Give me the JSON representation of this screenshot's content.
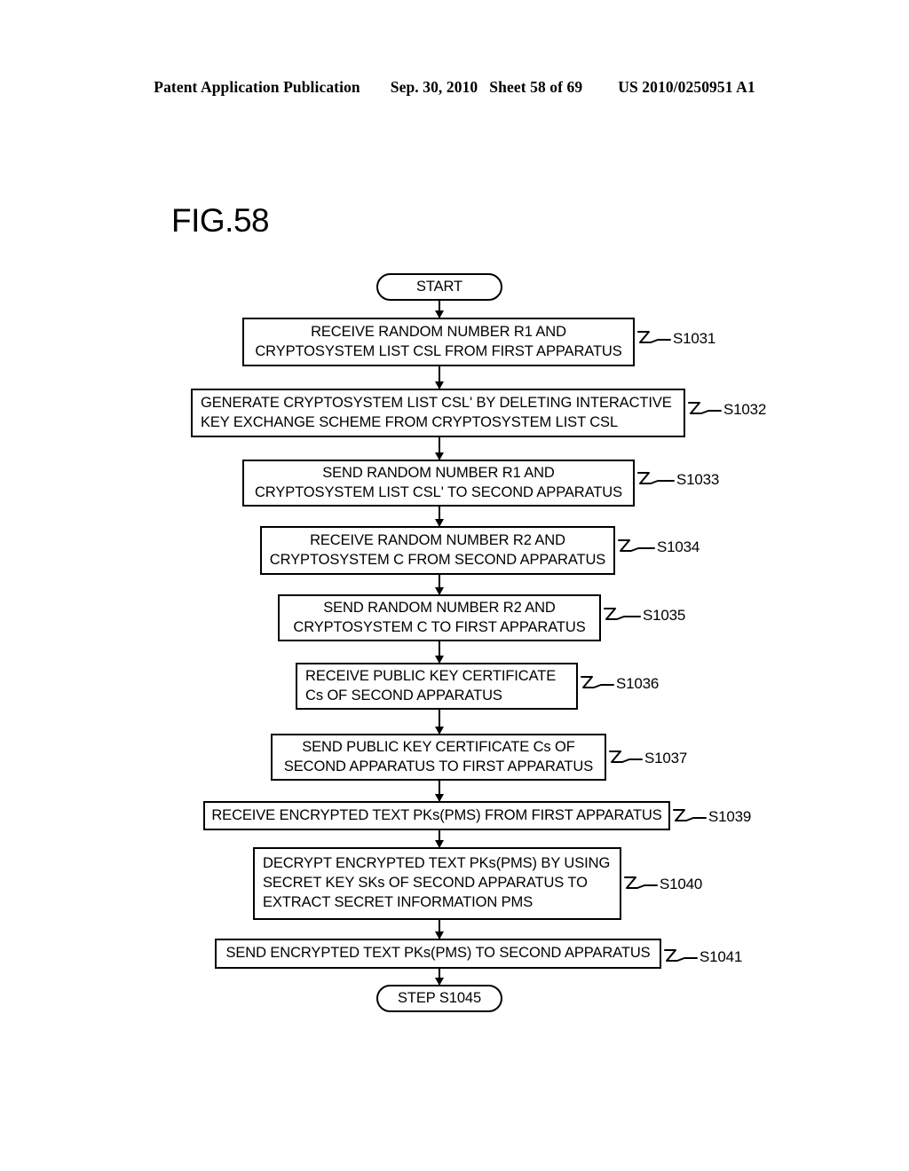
{
  "header": {
    "publication": "Patent Application Publication",
    "date": "Sep. 30, 2010",
    "sheet": "Sheet 58 of 69",
    "patent_number": "US 2010/0250951 A1"
  },
  "figure": {
    "label": "FIG.58"
  },
  "flowchart": {
    "start_label": "START",
    "end_label": "STEP S1045",
    "steps": [
      {
        "ref": "S1031",
        "lines": [
          "RECEIVE RANDOM NUMBER R1 AND",
          "CRYPTOSYSTEM LIST CSL FROM FIRST APPARATUS"
        ]
      },
      {
        "ref": "S1032",
        "lines": [
          "GENERATE CRYPTOSYSTEM LIST CSL' BY DELETING INTERACTIVE",
          "KEY EXCHANGE SCHEME FROM CRYPTOSYSTEM LIST CSL"
        ]
      },
      {
        "ref": "S1033",
        "lines": [
          "SEND RANDOM NUMBER R1 AND",
          "CRYPTOSYSTEM LIST CSL' TO SECOND APPARATUS"
        ]
      },
      {
        "ref": "S1034",
        "lines": [
          "RECEIVE RANDOM NUMBER R2 AND",
          "CRYPTOSYSTEM C FROM SECOND APPARATUS"
        ]
      },
      {
        "ref": "S1035",
        "lines": [
          "SEND RANDOM NUMBER R2 AND",
          "CRYPTOSYSTEM C TO FIRST APPARATUS"
        ]
      },
      {
        "ref": "S1036",
        "lines": [
          "RECEIVE PUBLIC KEY CERTIFICATE",
          "Cs OF SECOND APPARATUS"
        ]
      },
      {
        "ref": "S1037",
        "lines": [
          "SEND PUBLIC KEY CERTIFICATE Cs OF",
          "SECOND APPARATUS TO FIRST APPARATUS"
        ]
      },
      {
        "ref": "S1039",
        "lines": [
          "RECEIVE ENCRYPTED TEXT PKs(PMS) FROM FIRST APPARATUS"
        ]
      },
      {
        "ref": "S1040",
        "lines": [
          "DECRYPT ENCRYPTED TEXT PKs(PMS) BY USING",
          "SECRET KEY SKs OF SECOND APPARATUS TO",
          "EXTRACT SECRET INFORMATION PMS"
        ]
      },
      {
        "ref": "S1041",
        "lines": [
          "SEND ENCRYPTED TEXT PKs(PMS) TO SECOND APPARATUS"
        ]
      }
    ]
  }
}
